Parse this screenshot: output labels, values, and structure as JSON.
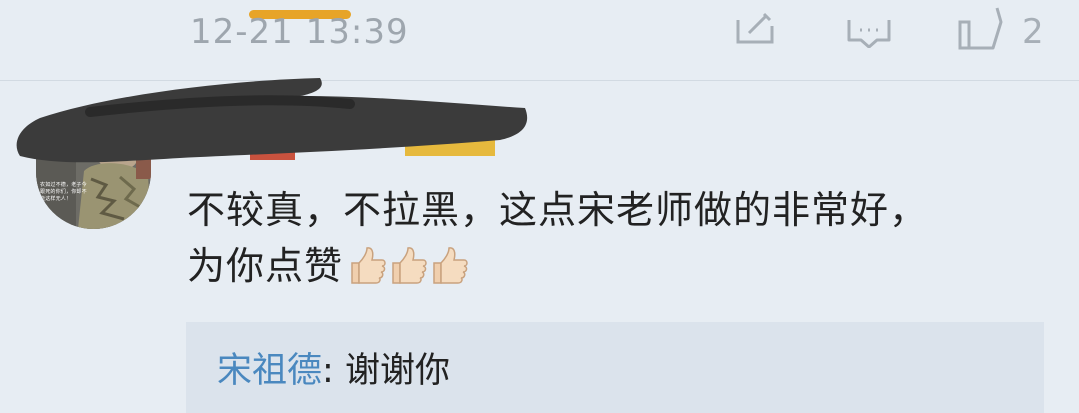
{
  "post_footer": {
    "timestamp": "12-21 13:39",
    "repost_icon": "repost-icon",
    "comment_icon": "comment-icon",
    "like_icon": "thumb-up-icon",
    "like_count": "2"
  },
  "comment": {
    "avatar_caption": "农如过不德，老子今跟死的你们，你却不能这样无人！",
    "line1": "不较真，不拉黑，这点宋老师做的非常好，",
    "line2": "为你点赞",
    "emoji": [
      "thumbs-up-emoji",
      "thumbs-up-emoji",
      "thumbs-up-emoji"
    ]
  },
  "reply": {
    "author": "宋祖德",
    "separator": ": ",
    "text": "谢谢你"
  },
  "colors": {
    "background": "#e7edf3",
    "reply_background": "#dbe3ec",
    "author_link": "#4a88bf",
    "accent_pill": "#e7a428",
    "muted": "#a7afb7"
  }
}
